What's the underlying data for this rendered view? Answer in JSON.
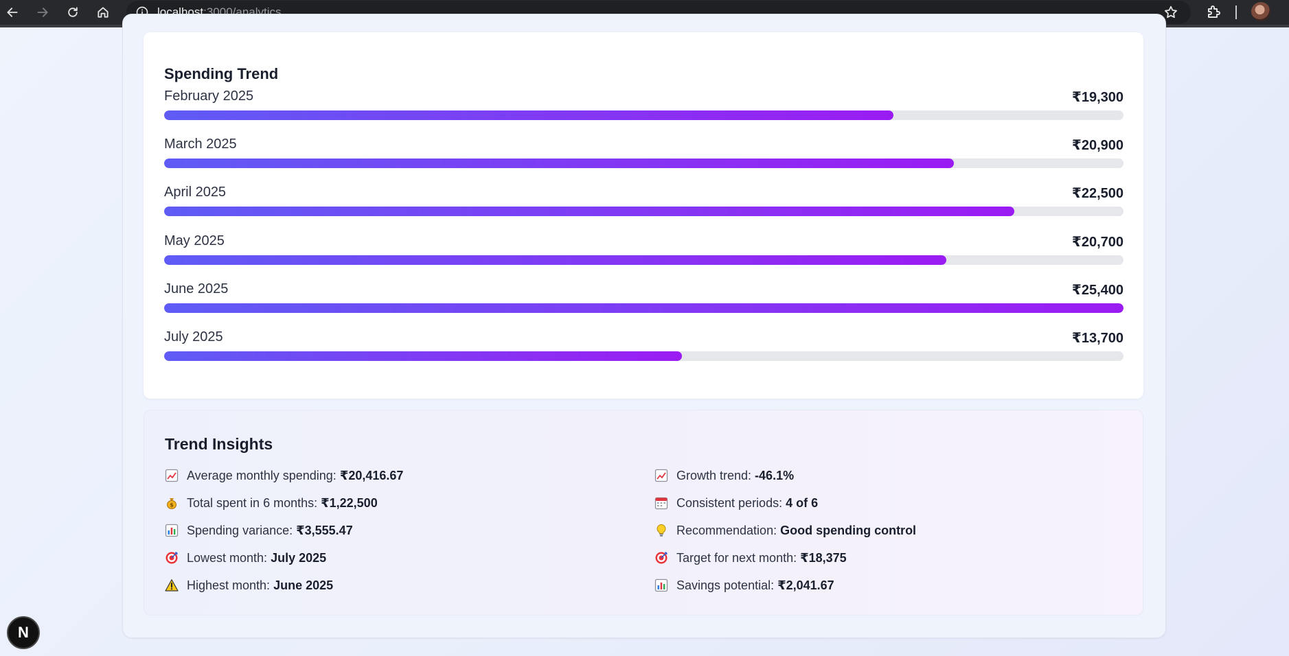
{
  "browser": {
    "url_host": "localhost",
    "url_rest": ":3000/analytics"
  },
  "spending_trend": {
    "title": "Spending Trend",
    "max_value": 25400,
    "rows": [
      {
        "month": "February 2025",
        "amount": "₹19,300",
        "value": 19300
      },
      {
        "month": "March 2025",
        "amount": "₹20,900",
        "value": 20900
      },
      {
        "month": "April 2025",
        "amount": "₹22,500",
        "value": 22500
      },
      {
        "month": "May 2025",
        "amount": "₹20,700",
        "value": 20700
      },
      {
        "month": "June 2025",
        "amount": "₹25,400",
        "value": 25400
      },
      {
        "month": "July 2025",
        "amount": "₹13,700",
        "value": 13700
      }
    ]
  },
  "insights": {
    "title": "Trend Insights",
    "left": [
      {
        "icon": "chart-up-icon",
        "label": "Average monthly spending:",
        "value": "₹20,416.67"
      },
      {
        "icon": "money-bag-icon",
        "label": "Total spent in 6 months:",
        "value": "₹1,22,500"
      },
      {
        "icon": "bar-chart-icon",
        "label": "Spending variance:",
        "value": "₹3,555.47"
      },
      {
        "icon": "target-icon",
        "label": "Lowest month:",
        "value": "July 2025"
      },
      {
        "icon": "warning-icon",
        "label": "Highest month:",
        "value": "June 2025"
      }
    ],
    "right": [
      {
        "icon": "chart-up-icon",
        "label": "Growth trend:",
        "value": "-46.1%"
      },
      {
        "icon": "calendar-icon",
        "label": "Consistent periods:",
        "value": "4 of 6"
      },
      {
        "icon": "lightbulb-icon",
        "label": "Recommendation:",
        "value": "Good spending control"
      },
      {
        "icon": "target-icon",
        "label": "Target for next month:",
        "value": "₹18,375"
      },
      {
        "icon": "bar-chart-icon",
        "label": "Savings potential:",
        "value": "₹2,041.67"
      }
    ]
  },
  "badge": {
    "letter": "N"
  }
}
